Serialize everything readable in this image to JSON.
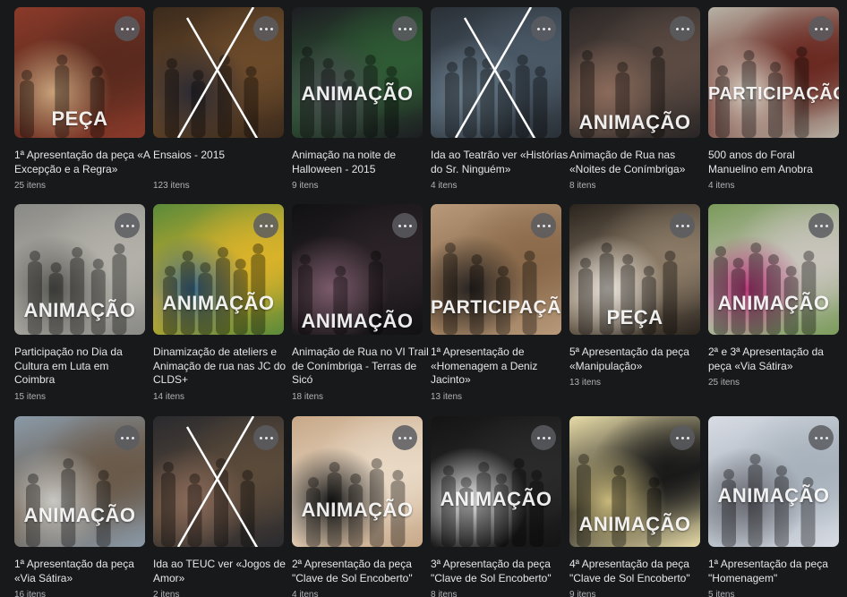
{
  "albums": [
    {
      "title": "1ª Apresentação da peça «A Excepção e a Regra»",
      "count": "25 itens",
      "overlay": "PEÇA",
      "crossed": false,
      "colors": [
        "#8a3a2a",
        "#5a2a1e",
        "#c9a27a"
      ]
    },
    {
      "title": "Ensaios - 2015",
      "count": "123 itens",
      "overlay": "",
      "crossed": true,
      "colors": [
        "#3b2a1c",
        "#6b4a2a",
        "#2b2a33"
      ]
    },
    {
      "title": "Animação na noite de Halloween - 2015",
      "count": "9 itens",
      "overlay": "ANIMAÇÃO",
      "crossed": false,
      "colors": [
        "#1d1d22",
        "#2e5a34",
        "#4a4a52"
      ]
    },
    {
      "title": "Ida ao Teatrão ver «Histórias do Sr. Ninguém»",
      "count": "4 itens",
      "overlay": "",
      "crossed": true,
      "colors": [
        "#2a3036",
        "#4a5866",
        "#6a7c8a"
      ]
    },
    {
      "title": "Animação de Rua nas «Noites de Conímbriga»",
      "count": "8 itens",
      "overlay": "ANIMAÇÃO",
      "crossed": false,
      "colors": [
        "#2a2626",
        "#5a4a42",
        "#8a6a5a"
      ]
    },
    {
      "title": "500 anos do Foral Manuelino em Anobra",
      "count": "4 itens",
      "overlay": "PARTICIPAÇÃO",
      "crossed": false,
      "colors": [
        "#b8b2a6",
        "#6a2a22",
        "#d8d2c6"
      ]
    },
    {
      "title": "Participação no Dia da Cultura em Luta em Coimbra",
      "count": "15 itens",
      "overlay": "ANIMAÇÃO",
      "crossed": false,
      "colors": [
        "#8a8a86",
        "#b2b0a8",
        "#5a5a56"
      ]
    },
    {
      "title": "Dinamização de ateliers e Animação de rua nas JC do CLDS+",
      "count": "14 itens",
      "overlay": "ANIMAÇÃO",
      "crossed": false,
      "colors": [
        "#5a8a3a",
        "#d8b22a",
        "#3a6a8a"
      ]
    },
    {
      "title": "Animação de Rua no VI Trail de Conímbriga - Terras de Sicó",
      "count": "18 itens",
      "overlay": "ANIMAÇÃO",
      "crossed": false,
      "colors": [
        "#111114",
        "#2a2226",
        "#7a5a6a"
      ]
    },
    {
      "title": "1ª Apresentação de «Homenagem a Deniz Jacinto»",
      "count": "13 itens",
      "overlay": "PARTICIPAÇÃO",
      "crossed": false,
      "colors": [
        "#b89a7a",
        "#8a6a4a",
        "#2a2624"
      ]
    },
    {
      "title": "5ª Apresentação da peça «Manipulação»",
      "count": "13 itens",
      "overlay": "PEÇA",
      "crossed": false,
      "colors": [
        "#2a241e",
        "#8a7a66",
        "#e8e2da"
      ]
    },
    {
      "title": "2ª e 3ª Apresentação da peça «Via Sátira»",
      "count": "25 itens",
      "overlay": "ANIMAÇÃO",
      "crossed": false,
      "colors": [
        "#7a9a5a",
        "#c8c4bc",
        "#b83a7a"
      ]
    },
    {
      "title": "1ª Apresentação da peça «Via Sátira»",
      "count": "16 itens",
      "overlay": "ANIMAÇÃO",
      "crossed": false,
      "colors": [
        "#8a9aa8",
        "#6a5a4a",
        "#c8c8c4"
      ]
    },
    {
      "title": "Ida ao TEUC ver «Jogos de Amor»",
      "count": "2 itens",
      "overlay": "",
      "crossed": true,
      "colors": [
        "#2a2a2e",
        "#5a4a3a",
        "#8a6a5a"
      ]
    },
    {
      "title": "2ª Apresentação da peça \"Clave de Sol Encoberto\"",
      "count": "4 itens",
      "overlay": "ANIMAÇÃO",
      "crossed": false,
      "colors": [
        "#c8a888",
        "#e8d8c4",
        "#1a1a1a"
      ]
    },
    {
      "title": "3ª Apresentação da peça \"Clave de Sol Encoberto\"",
      "count": "8 itens",
      "overlay": "ANIMAÇÃO",
      "crossed": false,
      "colors": [
        "#141414",
        "#2a2a2a",
        "#e8e8e8"
      ]
    },
    {
      "title": "4ª Apresentação da peça \"Clave de Sol Encoberto\"",
      "count": "9 itens",
      "overlay": "ANIMAÇÃO",
      "crossed": false,
      "colors": [
        "#e8dca8",
        "#1a1a1a",
        "#c8b87a"
      ]
    },
    {
      "title": "1ª Apresentação da peça \"Homenagem\"",
      "count": "5 itens",
      "overlay": "ANIMAÇÃO",
      "crossed": false,
      "colors": [
        "#d8dce4",
        "#a8b2bc",
        "#6a6a72"
      ]
    }
  ],
  "more_icon": "more-horizontal-icon"
}
